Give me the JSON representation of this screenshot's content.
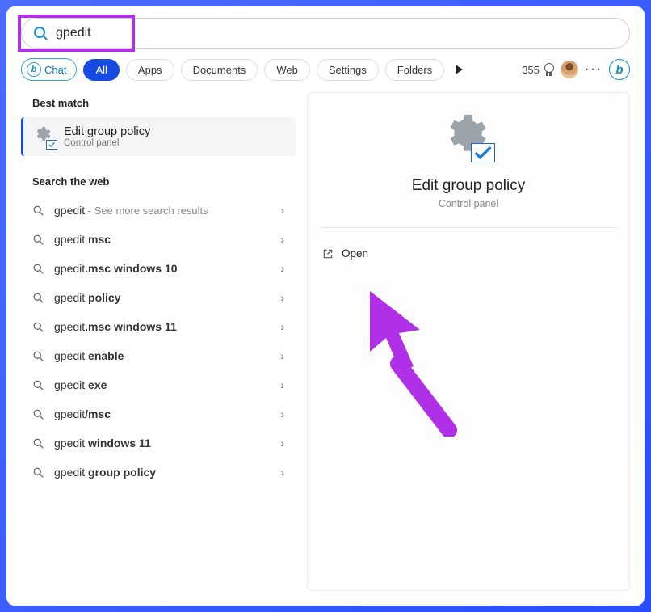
{
  "search": {
    "value": "gpedit"
  },
  "filters": {
    "chat": "Chat",
    "all": "All",
    "apps": "Apps",
    "documents": "Documents",
    "web": "Web",
    "settings": "Settings",
    "folders": "Folders"
  },
  "points": "355",
  "left": {
    "best_match_header": "Best match",
    "best_match": {
      "title": "Edit group policy",
      "subtitle": "Control panel"
    },
    "web_header": "Search the web",
    "items": [
      {
        "prefix": "gpedit",
        "bold": "",
        "suffix": " - See more search results"
      },
      {
        "prefix": "gpedit ",
        "bold": "msc",
        "suffix": ""
      },
      {
        "prefix": "gpedit",
        "bold": ".msc windows 10",
        "suffix": ""
      },
      {
        "prefix": "gpedit ",
        "bold": "policy",
        "suffix": ""
      },
      {
        "prefix": "gpedit",
        "bold": ".msc windows 11",
        "suffix": ""
      },
      {
        "prefix": "gpedit ",
        "bold": "enable",
        "suffix": ""
      },
      {
        "prefix": "gpedit ",
        "bold": "exe",
        "suffix": ""
      },
      {
        "prefix": "gpedit",
        "bold": "/msc",
        "suffix": ""
      },
      {
        "prefix": "gpedit ",
        "bold": "windows 11",
        "suffix": ""
      },
      {
        "prefix": "gpedit ",
        "bold": "group policy",
        "suffix": ""
      }
    ]
  },
  "right": {
    "title": "Edit group policy",
    "subtitle": "Control panel",
    "open": "Open"
  }
}
